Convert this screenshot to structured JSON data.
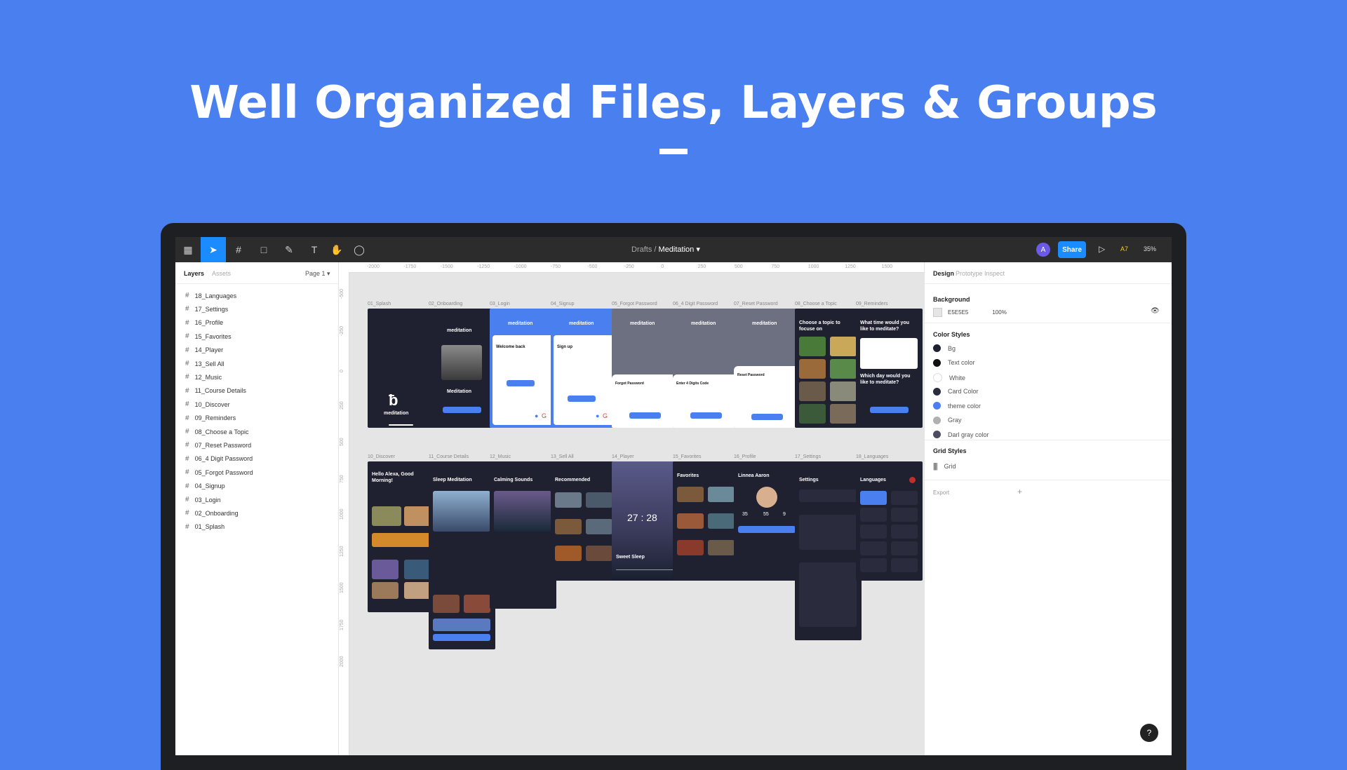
{
  "headline": "Well Organized Files, Layers & Groups",
  "toolbar": {
    "breadcrumb_parent": "Drafts",
    "separator": "/",
    "breadcrumb_current": "Meditation",
    "avatar_letter": "A",
    "share_label": "Share",
    "a7_label": "A7",
    "zoom_label": "35%"
  },
  "left_panel": {
    "tab_layers": "Layers",
    "tab_assets": "Assets",
    "page_label": "Page 1",
    "layers": [
      "18_Languages",
      "17_Settings",
      "16_Profile",
      "15_Favorites",
      "14_Player",
      "13_Sell All",
      "12_Music",
      "11_Course Details",
      "10_Discover",
      "09_Reminders",
      "08_Choose a Topic",
      "07_Reset Password",
      "06_4 Digit Password",
      "05_Forgot Password",
      "04_Signup",
      "03_Login",
      "02_Onboarding",
      "01_Splash"
    ]
  },
  "canvas": {
    "ruler_top": [
      "-2000",
      "-1750",
      "-1500",
      "-1250",
      "-1000",
      "-750",
      "-500",
      "-250",
      "0",
      "250",
      "500",
      "750",
      "1000",
      "1250",
      "1500"
    ],
    "ruler_left": [
      "-500",
      "-250",
      "0",
      "250",
      "500",
      "750",
      "1000",
      "1250",
      "1500",
      "1750",
      "2000"
    ],
    "row1_labels": [
      "01_Splash",
      "02_Onboarding",
      "03_Login",
      "04_Signup",
      "05_Forgot Password",
      "06_4 Digit Password",
      "07_Reset Password",
      "08_Choose a Topic",
      "09_Reminders"
    ],
    "row2_labels": [
      "10_Discover",
      "11_Course Details",
      "12_Music",
      "13_Sell All",
      "14_Player",
      "15_Favorites",
      "16_Profile",
      "17_Settings",
      "18_Languages"
    ],
    "screens": {
      "splash_logo": "meditation",
      "onboarding_title": "Meditation",
      "app_name": "meditation",
      "login_title": "Welcome back",
      "signup_title": "Sign up",
      "forgot_title": "Forgot Password",
      "digit_title": "Enter 4 Digits Code",
      "reset_title": "Reset Password",
      "topic_title": "Choose a topic to focuse on",
      "reminder_title": "What time would you like to meditate?",
      "reminder_q2": "Which day would you like to meditate?",
      "discover_title": "Hello Alexa, Good Morning!",
      "course_title": "Sleep Meditation",
      "music_title": "Calming Sounds",
      "sellall_title": "Recommended",
      "player_title": "Sweet Sleep",
      "player_time": "27 : 28",
      "fav_title": "Favorites",
      "profile_title": "Linnea Aaron",
      "profile_stats": [
        "35",
        "55",
        "9"
      ],
      "settings_title": "Settings",
      "languages_title": "Languages"
    }
  },
  "right_panel": {
    "tab_design": "Design",
    "tab_prototype": "Prototype",
    "tab_inspect": "Inspect",
    "background_heading": "Background",
    "background_hex": "E5E5E5",
    "background_opacity": "100%",
    "color_styles_heading": "Color Styles",
    "color_styles": [
      {
        "name": "Bg",
        "color": "#1f2030"
      },
      {
        "name": "Text color",
        "color": "#111111"
      },
      {
        "name": "White",
        "color": "#ffffff"
      },
      {
        "name": "Card Color",
        "color": "#2a2b3d"
      },
      {
        "name": "theme color",
        "color": "#4a7ff0"
      },
      {
        "name": "Gray",
        "color": "#b0b0b0"
      },
      {
        "name": "Darl gray color",
        "color": "#4a4d60"
      }
    ],
    "grid_styles_heading": "Grid Styles",
    "grid_label": "Grid",
    "export_label": "Export"
  },
  "help_label": "?"
}
